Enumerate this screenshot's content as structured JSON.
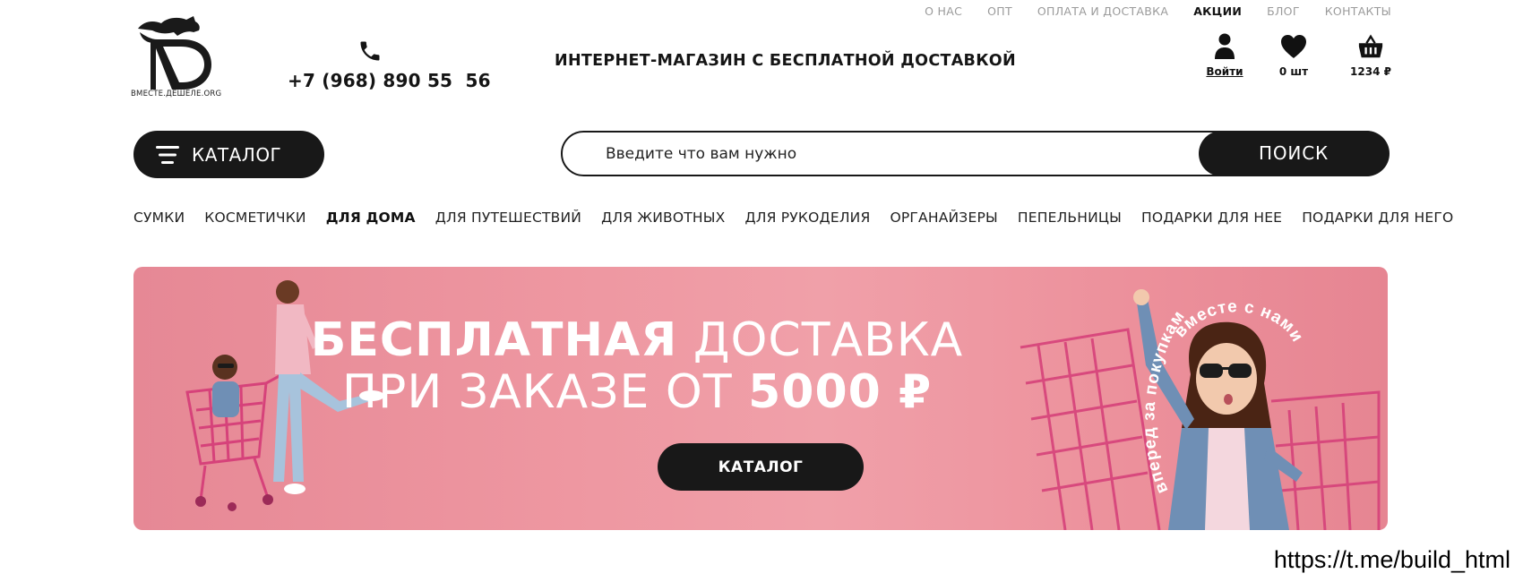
{
  "top_nav": [
    "О НАС",
    "ОПТ",
    "ОПЛАТА И ДОСТАВКА",
    "АКЦИИ",
    "БЛОГ",
    "КОНТАКТЫ"
  ],
  "top_nav_active": "АКЦИИ",
  "logo": {
    "caption": "ВМЕСТЕ.ДЕШЕЛЕ.ORG",
    "icon": "bull-logo-icon"
  },
  "header": {
    "phone": "+7 (968) 890 55  56",
    "slogan": "ИНТЕРНЕТ-МАГАЗИН С БЕСПЛАТНОЙ ДОСТАВКОЙ"
  },
  "actions": {
    "login": {
      "label": "Войти",
      "icon": "user-icon"
    },
    "favorites": {
      "label": "0 шт",
      "icon": "heart-icon"
    },
    "cart": {
      "label": "1234 ₽",
      "icon": "basket-icon"
    }
  },
  "catalog_button": {
    "label": "КАТАЛОГ",
    "icon": "menu-icon"
  },
  "search": {
    "placeholder": "Введите что вам нужно",
    "value": "",
    "button_label": "ПОИСК"
  },
  "categories": [
    "СУМКИ",
    "КОСМЕТИЧКИ",
    "ДЛЯ ДОМА",
    "ДЛЯ ПУТЕШЕСТВИЙ",
    "ДЛЯ ЖИВОТНЫХ",
    "ДЛЯ РУКОДЕЛИЯ",
    "ОРГАНАЙЗЕРЫ",
    "ПЕПЕЛЬНИЦЫ",
    "ПОДАРКИ ДЛЯ НЕЕ",
    "ПОДАРКИ ДЛЯ НЕГО"
  ],
  "categories_active": "ДЛЯ ДОМА",
  "banner": {
    "line1_bold": "БЕСПЛАТНАЯ",
    "line1_thin": "ДОСТАВКА",
    "line2_thin": "ПРИ ЗАКАЗЕ ОТ",
    "line2_bold": "5000 ₽",
    "button_label": "КАТАЛОГ",
    "curved_text_1": "вперед за покупками",
    "curved_text_2": "вместе с нами",
    "background": "#ee97a1"
  },
  "watermark": "https://t.me/build_html"
}
